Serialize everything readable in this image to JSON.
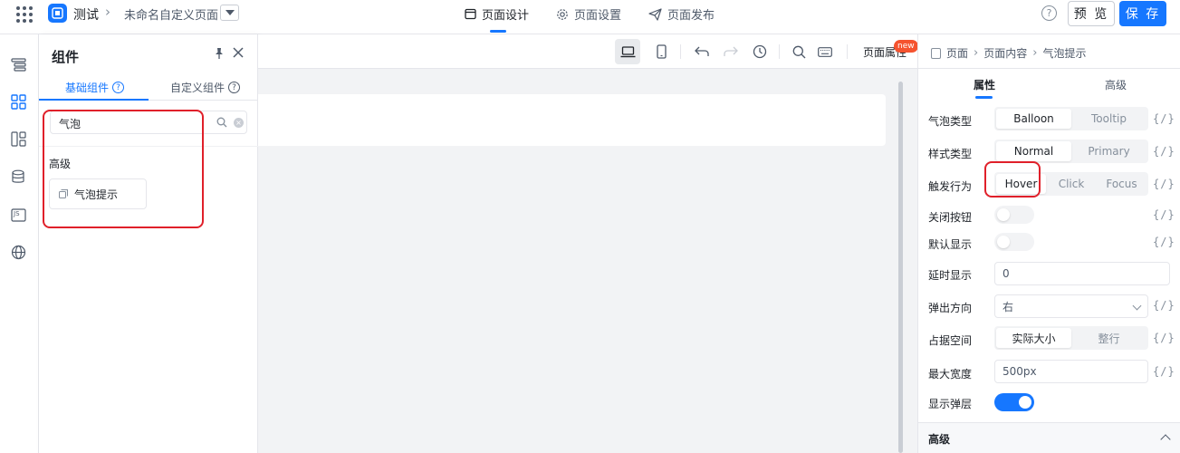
{
  "header": {
    "app_name": "测试",
    "page_name": "未命名自定义页面",
    "nav_tabs": [
      {
        "label": "页面设计",
        "icon": "layout-icon",
        "active": true
      },
      {
        "label": "页面设置",
        "icon": "gear-icon",
        "active": false
      },
      {
        "label": "页面发布",
        "icon": "send-icon",
        "active": false
      }
    ],
    "help_label": "?",
    "preview_label": "预 览",
    "save_label": "保 存",
    "accent_color": "#1677ff"
  },
  "left_rail": {
    "icons": [
      "outline-icon",
      "components-icon",
      "layout-templates-icon",
      "datasource-icon",
      "js-icon",
      "globe-icon"
    ],
    "js_label": "JS"
  },
  "component_panel": {
    "title": "组件",
    "tabs": [
      {
        "label": "基础组件",
        "active": true
      },
      {
        "label": "自定义组件",
        "active": false
      }
    ],
    "search_value": "气泡",
    "group_label": "高级",
    "items": [
      {
        "label": "气泡提示",
        "icon": "component-icon"
      }
    ]
  },
  "canvas": {
    "toolbar": {
      "page_props_label": "页面属性",
      "new_badge": "new"
    }
  },
  "props_panel": {
    "breadcrumb": [
      "页面",
      "页面内容",
      "气泡提示"
    ],
    "tabs": [
      {
        "label": "属性",
        "active": true
      },
      {
        "label": "高级",
        "active": false
      }
    ],
    "expr_label": "{/}",
    "rows": {
      "balloon_type": {
        "label": "气泡类型",
        "options": [
          "Balloon",
          "Tooltip"
        ],
        "selected": "Balloon"
      },
      "style_type": {
        "label": "样式类型",
        "options": [
          "Normal",
          "Primary"
        ],
        "selected": "Normal"
      },
      "trigger": {
        "label": "触发行为",
        "options": [
          "Hover",
          "Click",
          "Focus"
        ],
        "selected": "Hover"
      },
      "close_button": {
        "label": "关闭按钮",
        "on": false
      },
      "default_visible": {
        "label": "默认显示",
        "on": false
      },
      "delay": {
        "label": "延时显示",
        "value": "0"
      },
      "align": {
        "label": "弹出方向",
        "value": "右"
      },
      "occupy": {
        "label": "占据空间",
        "options": [
          "实际大小",
          "整行"
        ],
        "selected": "实际大小"
      },
      "max_width": {
        "label": "最大宽度",
        "value": "500px"
      },
      "show_popup": {
        "label": "显示弹层",
        "on": true
      }
    },
    "advanced_section": "高级"
  },
  "highlight_color": "#e0202a"
}
